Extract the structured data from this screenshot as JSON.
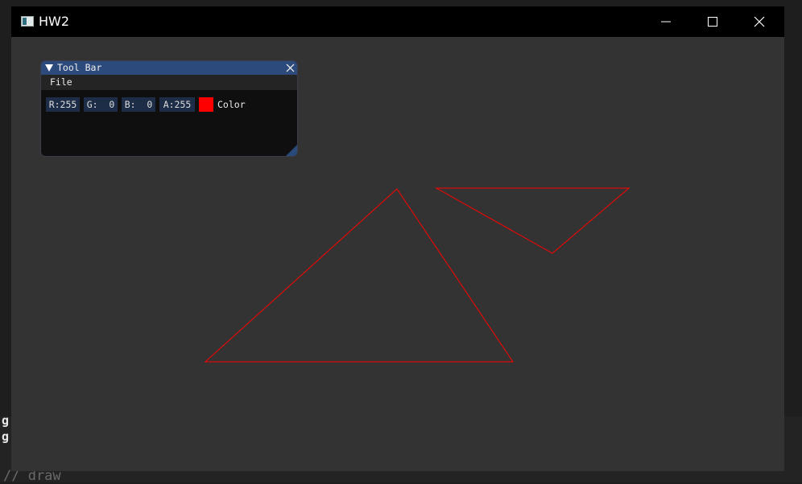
{
  "window": {
    "title": "HW2",
    "controls": [
      "minimize-icon",
      "maximize-icon",
      "close-icon"
    ]
  },
  "toolbar": {
    "title": "Tool Bar",
    "menu": {
      "file": "File"
    },
    "fields": {
      "r": "R:255",
      "g": "G:  0",
      "b": "B:  0",
      "a": "A:255"
    },
    "swatch_color": "#ff0000",
    "color_label": "Color"
  },
  "background_editor": {
    "line1": "g",
    "line2": "g",
    "comment": "// draw"
  },
  "colors": {
    "canvas_bg": "#333333",
    "stroke": "#ff0000",
    "titlebar": "#000000",
    "panel_title": "#2c4a7c"
  }
}
